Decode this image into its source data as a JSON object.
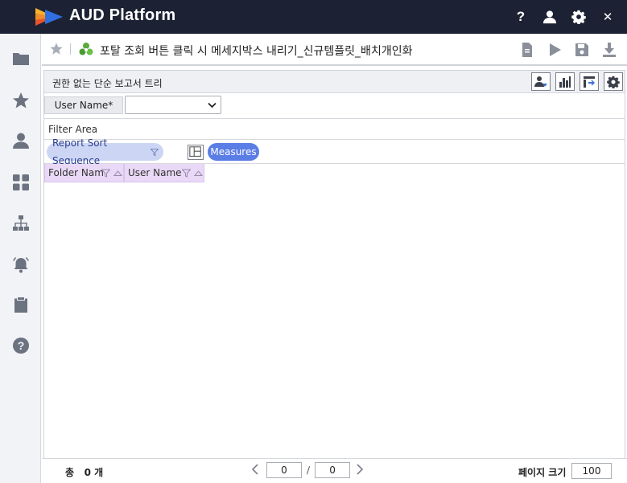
{
  "app": {
    "brand": "AUD Platform"
  },
  "header": {
    "icons": [
      "help-icon",
      "user-icon",
      "gear-icon",
      "close-icon"
    ],
    "help_glyph": "?",
    "close_glyph": "✕"
  },
  "sidebar": {
    "items": [
      "folder-icon",
      "star-icon",
      "person-icon",
      "dashboard-icon",
      "hierarchy-icon",
      "alarm-icon",
      "clipboard-icon",
      "help-circle-icon"
    ]
  },
  "report": {
    "title": "포탈 조회 버튼 클릭 시 메세지박스 내리기_신규템플릿_배치개인화"
  },
  "panel": {
    "title": "권한 없는 단순 보고서 트리",
    "param_label": "User Name*",
    "param_value": "",
    "filter_area": "Filter Area",
    "sort_chip": "Report Sort Sequence",
    "measures_chip": "Measures",
    "columns": [
      "Folder Nam",
      "User Name"
    ]
  },
  "footer": {
    "total_label": "총",
    "total_count": "0",
    "total_unit": "개",
    "current_page": "0",
    "page_separator": "/",
    "total_pages": "0",
    "page_size_label": "페이지 크기",
    "page_size": "100"
  },
  "colors": {
    "topbar": "#1c2233",
    "sort_chip_bg": "#ccd6f4",
    "measures_chip_bg": "#5b7de6",
    "column_header_bg": "#e9d9f6"
  }
}
